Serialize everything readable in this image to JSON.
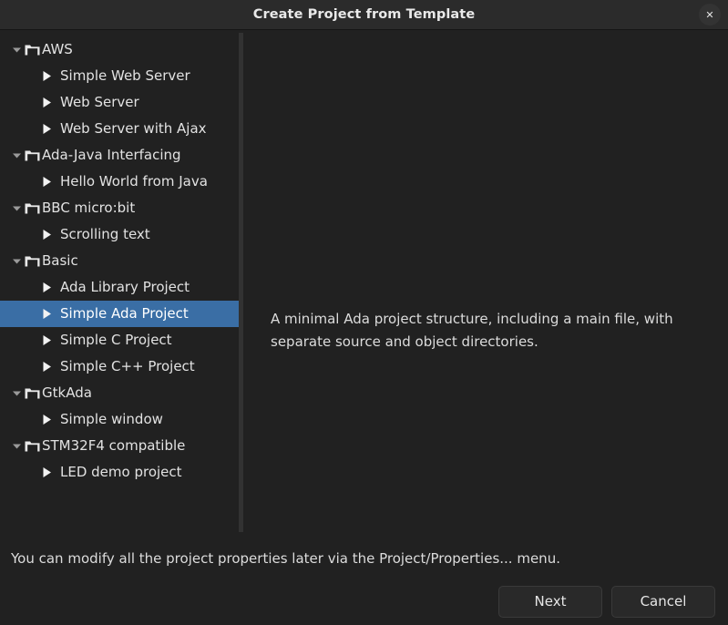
{
  "window": {
    "title": "Create Project from Template",
    "close_label": "✕",
    "close_icon": "close-icon"
  },
  "tree": {
    "selected_label": "Simple Ada Project",
    "items": [
      {
        "label": "AWS",
        "type": "group",
        "icon": "folder-icon",
        "expander": "chevron-down-icon",
        "selected": false
      },
      {
        "label": "Simple Web Server",
        "type": "leaf",
        "icon": "triangle-right-icon",
        "selected": false
      },
      {
        "label": "Web Server",
        "type": "leaf",
        "icon": "triangle-right-icon",
        "selected": false
      },
      {
        "label": "Web Server with Ajax",
        "type": "leaf",
        "icon": "triangle-right-icon",
        "selected": false
      },
      {
        "label": "Ada-Java Interfacing",
        "type": "group",
        "icon": "folder-icon",
        "expander": "chevron-down-icon",
        "selected": false
      },
      {
        "label": "Hello World from Java",
        "type": "leaf",
        "icon": "triangle-right-icon",
        "selected": false
      },
      {
        "label": "BBC micro:bit",
        "type": "group",
        "icon": "folder-icon",
        "expander": "chevron-down-icon",
        "selected": false
      },
      {
        "label": "Scrolling text",
        "type": "leaf",
        "icon": "triangle-right-icon",
        "selected": false
      },
      {
        "label": "Basic",
        "type": "group",
        "icon": "folder-icon",
        "expander": "chevron-down-icon",
        "selected": false
      },
      {
        "label": "Ada Library Project",
        "type": "leaf",
        "icon": "triangle-right-icon",
        "selected": false
      },
      {
        "label": "Simple Ada Project",
        "type": "leaf",
        "icon": "triangle-right-icon",
        "selected": true
      },
      {
        "label": "Simple C Project",
        "type": "leaf",
        "icon": "triangle-right-icon",
        "selected": false
      },
      {
        "label": "Simple C++ Project",
        "type": "leaf",
        "icon": "triangle-right-icon",
        "selected": false
      },
      {
        "label": "GtkAda",
        "type": "group",
        "icon": "folder-icon",
        "expander": "chevron-down-icon",
        "selected": false
      },
      {
        "label": "Simple window",
        "type": "leaf",
        "icon": "triangle-right-icon",
        "selected": false
      },
      {
        "label": "STM32F4 compatible",
        "type": "group",
        "icon": "folder-icon",
        "expander": "chevron-down-icon",
        "selected": false
      },
      {
        "label": "LED demo project",
        "type": "leaf",
        "icon": "triangle-right-icon",
        "selected": false
      }
    ]
  },
  "description": {
    "text": "A minimal Ada project structure, including a main file, with separate source and object directories."
  },
  "footer": {
    "note": "You can modify all the project properties later via the Project/Properties... menu.",
    "next_label": "Next",
    "cancel_label": "Cancel"
  },
  "colors": {
    "window_background": "#212121",
    "titlebar_background": "#2b2b2b",
    "selection": "#3a6ea5",
    "text": "#e2e2e2",
    "splitter": "#323232",
    "button_background": "#292929",
    "button_border": "#3a3a3a"
  }
}
